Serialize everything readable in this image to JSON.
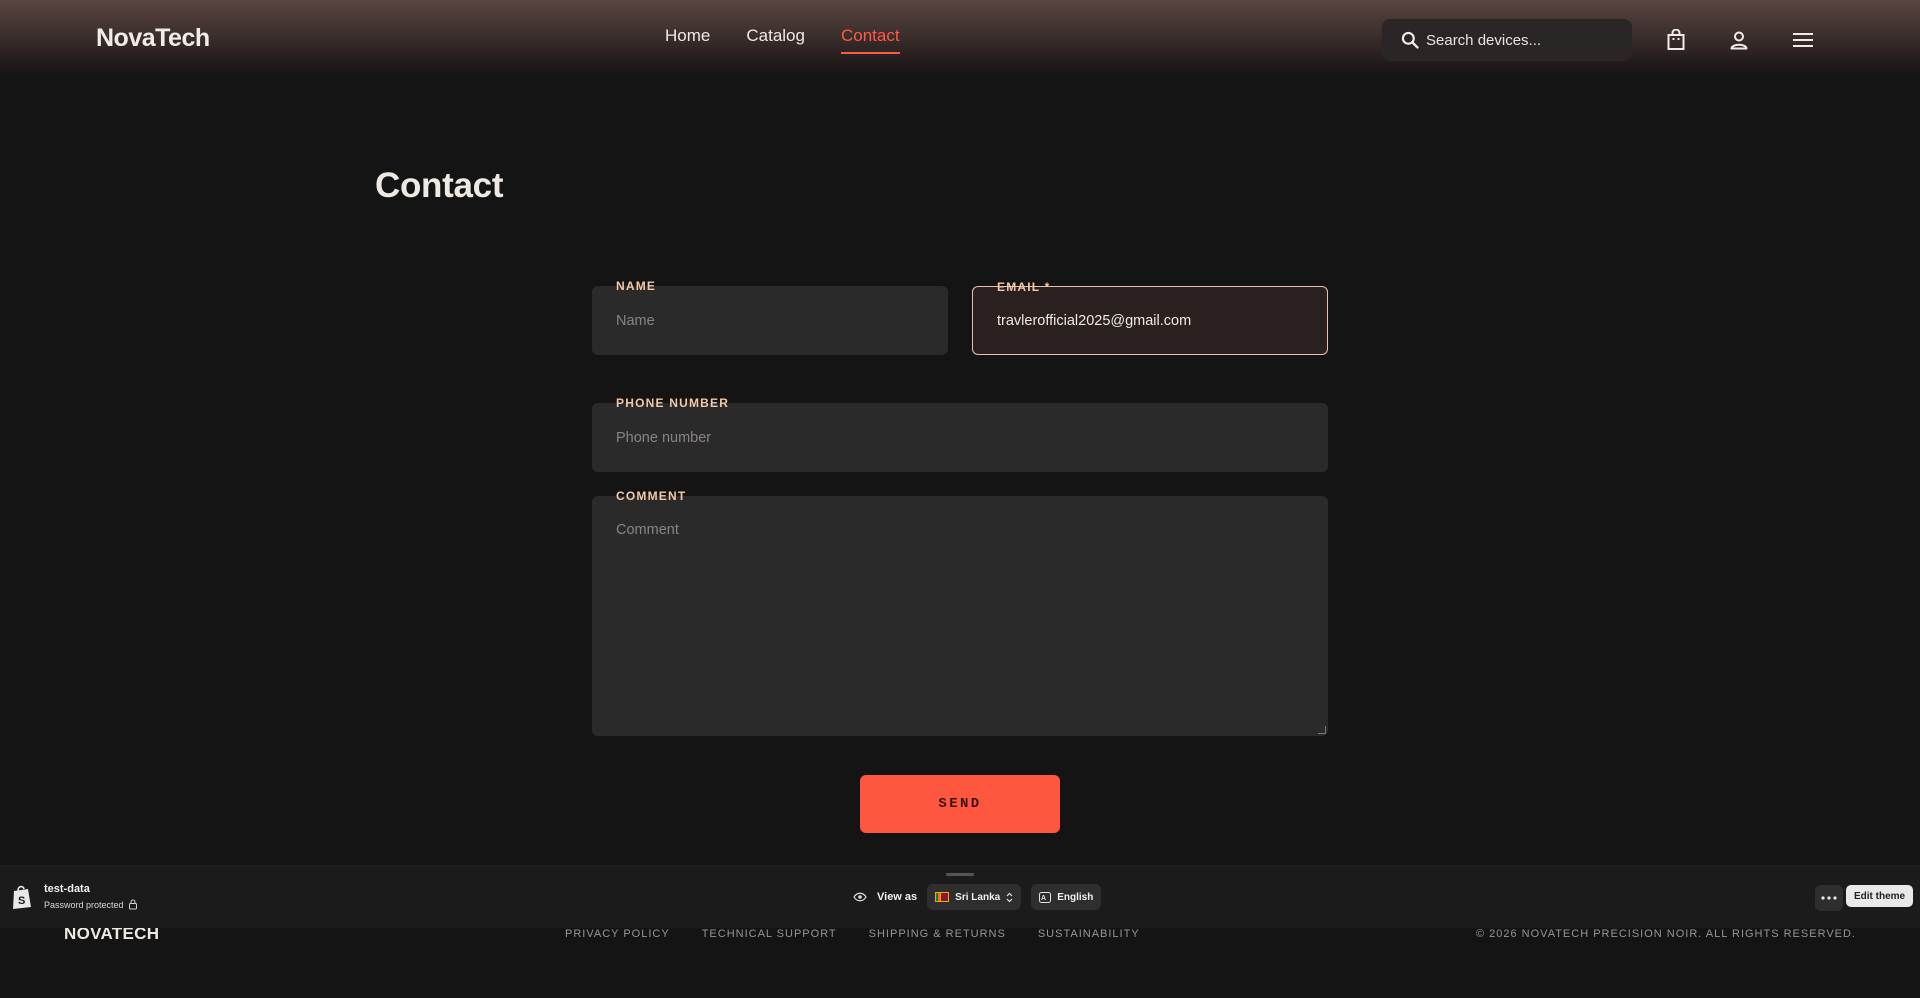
{
  "header": {
    "logo": "NovaTech",
    "nav": [
      {
        "label": "Home",
        "active": false
      },
      {
        "label": "Catalog",
        "active": false
      },
      {
        "label": "Contact",
        "active": true
      }
    ],
    "search_placeholder": "Search devices...",
    "icons": [
      "search-icon",
      "shopping-bag-icon",
      "user-icon",
      "menu-icon"
    ]
  },
  "main": {
    "title": "Contact",
    "form": {
      "name_label": "NAME",
      "name_placeholder": "Name",
      "email_label": "EMAIL *",
      "email_value": "travlerofficial2025@gmail.com",
      "phone_label": "PHONE NUMBER",
      "phone_placeholder": "Phone number",
      "comment_label": "COMMENT",
      "comment_placeholder": "Comment",
      "send_label": "SEND"
    }
  },
  "footer": {
    "logo": "NOVATECH",
    "links": [
      "PRIVACY POLICY",
      "TECHNICAL SUPPORT",
      "SHIPPING & RETURNS",
      "SUSTAINABILITY"
    ],
    "copyright": "© 2026 NOVATECH PRECISION NOIR. ALL RIGHTS RESERVED."
  },
  "preview_bar": {
    "store_name": "test-data",
    "store_status": "Password protected",
    "view_as_label": "View as",
    "country": "Sri Lanka",
    "language": "English",
    "edit_theme_label": "Edit theme"
  },
  "colors": {
    "accent": "#ff5a42",
    "background": "#141414",
    "field_bg": "#2a2a2a",
    "label_color": "#f2c9a8"
  }
}
